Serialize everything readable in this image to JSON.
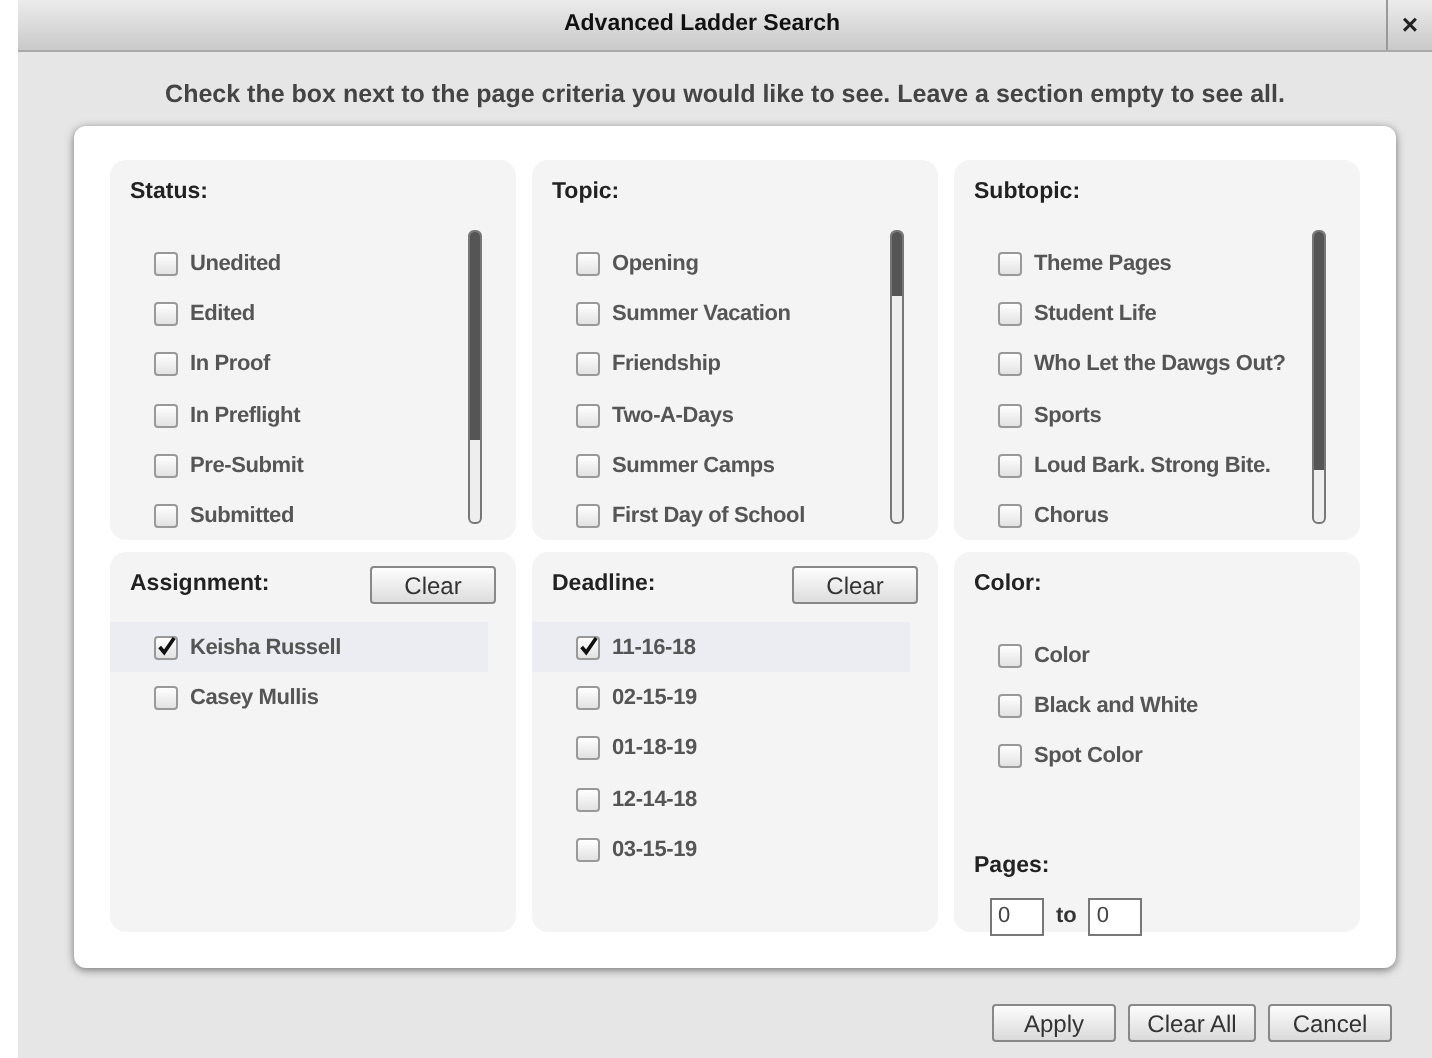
{
  "window": {
    "title": "Advanced Ladder Search",
    "close": "×"
  },
  "instruction": "Check the box next to the page criteria you would like to see. Leave a section empty to see all.",
  "sections": [
    {
      "title": "Status:",
      "scrollbar": true,
      "items": [
        {
          "label": "Unedited",
          "checked": false
        },
        {
          "label": "Edited",
          "checked": false
        },
        {
          "label": "In Proof",
          "checked": false
        },
        {
          "label": "In Preflight",
          "checked": false
        },
        {
          "label": "Pre-Submit",
          "checked": false
        },
        {
          "label": "Submitted",
          "checked": false
        }
      ]
    },
    {
      "title": "Topic:",
      "scrollbar": true,
      "items": [
        {
          "label": "Opening",
          "checked": false
        },
        {
          "label": "Summer Vacation",
          "checked": false
        },
        {
          "label": "Friendship",
          "checked": false
        },
        {
          "label": "Two-A-Days",
          "checked": false
        },
        {
          "label": "Summer Camps",
          "checked": false
        },
        {
          "label": "First Day of School",
          "checked": false
        }
      ]
    },
    {
      "title": "Subtopic:",
      "scrollbar": true,
      "items": [
        {
          "label": "Theme Pages",
          "checked": false
        },
        {
          "label": "Student Life",
          "checked": false
        },
        {
          "label": "Who Let the Dawgs Out?",
          "checked": false
        },
        {
          "label": "Sports",
          "checked": false
        },
        {
          "label": "Loud Bark. Strong Bite.",
          "checked": false
        },
        {
          "label": "Chorus",
          "checked": false
        }
      ]
    },
    {
      "title": "Assignment:",
      "clear_button": "Clear",
      "items": [
        {
          "label": "Keisha Russell",
          "checked": true
        },
        {
          "label": "Casey Mullis",
          "checked": false
        }
      ]
    },
    {
      "title": "Deadline:",
      "clear_button": "Clear",
      "items": [
        {
          "label": "11-16-18",
          "checked": true
        },
        {
          "label": "02-15-19",
          "checked": false
        },
        {
          "label": "01-18-19",
          "checked": false
        },
        {
          "label": "12-14-18",
          "checked": false
        },
        {
          "label": "03-15-19",
          "checked": false
        }
      ]
    },
    {
      "title": "Color:",
      "items": [
        {
          "label": "Color",
          "checked": false
        },
        {
          "label": "Black and White",
          "checked": false
        },
        {
          "label": "Spot Color",
          "checked": false
        }
      ],
      "pages": {
        "label": "Pages:",
        "from": "0",
        "separator": "to",
        "to": "0"
      }
    }
  ],
  "buttons": [
    "Apply",
    "Clear All",
    "Cancel"
  ]
}
